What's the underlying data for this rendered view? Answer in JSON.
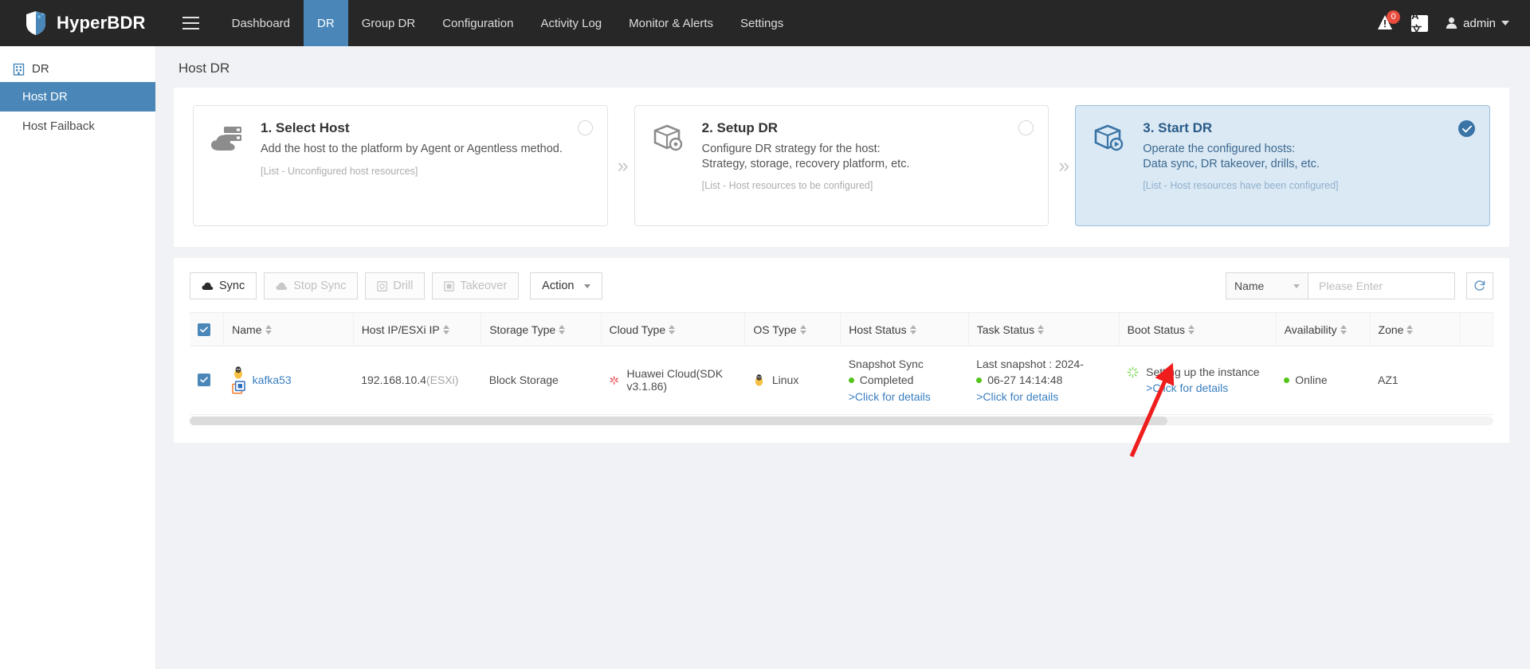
{
  "header": {
    "brand": "HyperBDR",
    "menu_icon": "hamburger-icon",
    "nav": [
      {
        "label": "Dashboard",
        "active": false
      },
      {
        "label": "DR",
        "active": true
      },
      {
        "label": "Group DR",
        "active": false
      },
      {
        "label": "Configuration",
        "active": false
      },
      {
        "label": "Activity Log",
        "active": false
      },
      {
        "label": "Monitor & Alerts",
        "active": false
      },
      {
        "label": "Settings",
        "active": false
      }
    ],
    "alert_badge": "0",
    "lang_label": "A文",
    "user": "admin"
  },
  "sidebar": {
    "group_label": "DR",
    "items": [
      {
        "label": "Host DR",
        "active": true
      },
      {
        "label": "Host Failback",
        "active": false
      }
    ]
  },
  "page": {
    "title": "Host DR"
  },
  "steps": [
    {
      "title": "1. Select Host",
      "desc_lines": [
        "Add the host to the platform by Agent or Agentless method."
      ],
      "note": "[List - Unconfigured host resources]",
      "state": "incomplete",
      "icon": "cloud-server-icon"
    },
    {
      "title": "2. Setup DR",
      "desc_lines": [
        "Configure DR strategy for the host:",
        "Strategy, storage, recovery platform, etc."
      ],
      "note": "[List - Host resources to be configured]",
      "state": "incomplete",
      "icon": "box-gear-icon"
    },
    {
      "title": "3. Start DR",
      "desc_lines": [
        "Operate the configured hosts:",
        "Data sync, DR takeover, drills, etc."
      ],
      "note": "[List - Host resources have been configured]",
      "state": "complete",
      "icon": "box-play-icon"
    }
  ],
  "separator": "»",
  "toolbar": {
    "buttons": [
      {
        "label": "Sync",
        "icon": "cloud-up-icon",
        "disabled": false
      },
      {
        "label": "Stop Sync",
        "icon": "cloud-stop-icon",
        "disabled": true
      },
      {
        "label": "Drill",
        "icon": "drill-icon",
        "disabled": true
      },
      {
        "label": "Takeover",
        "icon": "takeover-icon",
        "disabled": true
      },
      {
        "label": "Action",
        "icon": "chevron-down-icon",
        "disabled": false
      }
    ],
    "filter_field": "Name",
    "search_placeholder": "Please Enter",
    "search_value": "",
    "refresh_icon": "refresh-icon"
  },
  "table": {
    "select_all_checked": true,
    "columns": [
      {
        "label": "Name",
        "sortable": true
      },
      {
        "label": "Host IP/ESXi IP",
        "sortable": true
      },
      {
        "label": "Storage Type",
        "sortable": true
      },
      {
        "label": "Cloud Type",
        "sortable": true
      },
      {
        "label": "OS Type",
        "sortable": true
      },
      {
        "label": "Host Status",
        "sortable": true
      },
      {
        "label": "Task Status",
        "sortable": true
      },
      {
        "label": "Boot Status",
        "sortable": true
      },
      {
        "label": "Availability",
        "sortable": true
      },
      {
        "label": "Zone",
        "sortable": true
      }
    ],
    "rows": [
      {
        "checked": true,
        "name": "kafka53",
        "name_os_icon": "linux-penguin-icon",
        "name_vm_icon": "vm-instance-icon",
        "host_ip": "192.168.10.4",
        "host_ip_suffix": "(ESXi)",
        "storage_type": "Block Storage",
        "cloud_type": "Huawei Cloud(SDK v3.1.86)",
        "cloud_icon": "huawei-cloud-icon",
        "os_type": "Linux",
        "os_icon": "linux-penguin-icon",
        "host_status_title": "Snapshot Sync",
        "host_status_value": "Completed",
        "host_status_link": ">Click for details",
        "task_status_title": "Last snapshot : 2024-",
        "task_status_value": "06-27 14:14:48",
        "task_status_link": ">Click for details",
        "boot_status_value": "Setting up the instance",
        "boot_status_link": ">Click for details",
        "boot_status_icon": "loading-spinner-icon",
        "availability": "Online",
        "zone": "AZ1"
      }
    ]
  },
  "annotation": {
    "arrow": "red-arrow-pointing-to-boot-status-link"
  },
  "colors": {
    "accent_blue": "#4a87b8",
    "link_blue": "#3a7fc1",
    "status_green": "#52c41a",
    "badge_red": "#e74c3c",
    "annotation_red": "#f01d1d",
    "nav_dark": "#272727"
  }
}
